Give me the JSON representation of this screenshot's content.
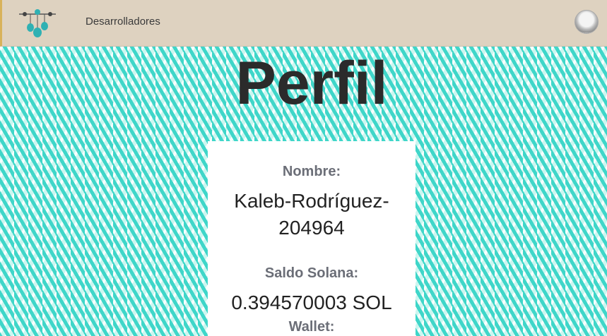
{
  "navbar": {
    "logo_icon": "balloons-logo-icon",
    "link_label": "Desarrolladores",
    "avatar_icon": "user-avatar-icon"
  },
  "page": {
    "title": "Perfil"
  },
  "profile": {
    "name_label": "Nombre:",
    "name_value_line1": "Kaleb-Rodríguez-",
    "name_value_line2": "204964",
    "balance_label": "Saldo Solana:",
    "balance_value": "0.394570003 SOL",
    "wallet_label": "Wallet:"
  },
  "colors": {
    "navbar_bg": "#ded2c0",
    "pattern_teal": "#3fd6c9",
    "title_text": "#2b2b2b",
    "label_text": "#6b6e77"
  }
}
